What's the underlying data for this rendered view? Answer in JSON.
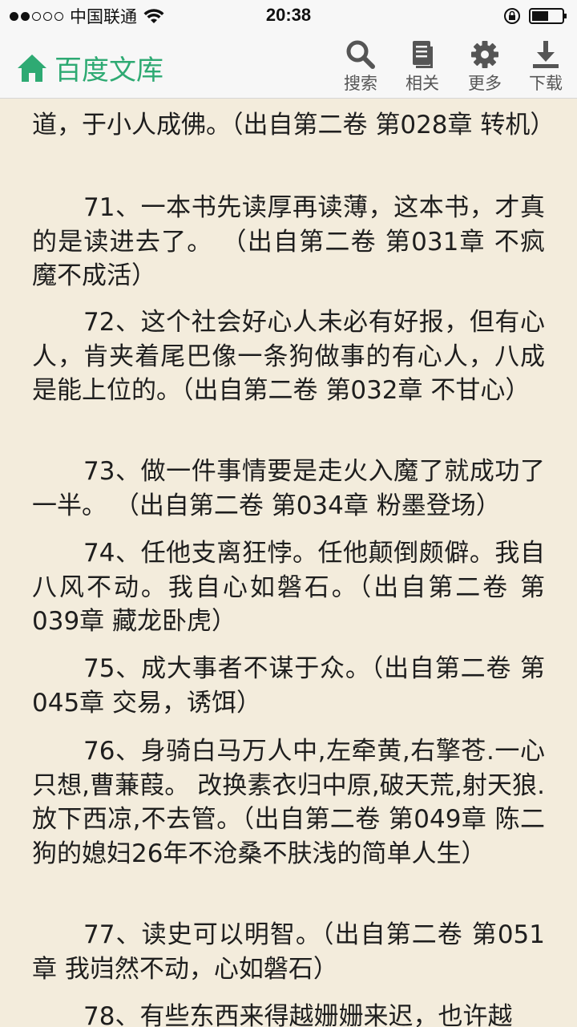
{
  "status_bar": {
    "carrier": "中国联通",
    "time": "20:38",
    "signal_bars_filled": 2,
    "signal_bars_total": 5
  },
  "toolbar": {
    "title": "百度文库",
    "brand_color": "#2eaa73",
    "actions": [
      {
        "label": "搜索",
        "icon": "search-icon"
      },
      {
        "label": "相关",
        "icon": "document-icon"
      },
      {
        "label": "更多",
        "icon": "gear-icon"
      },
      {
        "label": "下载",
        "icon": "download-icon"
      }
    ]
  },
  "content": {
    "paragraphs": [
      "道，于小人成佛。（出自第二卷 第028章 转机）",
      "71、一本书先读厚再读薄，这本书，才真的是读进去了。 （出自第二卷 第031章 不疯魔不成活）",
      "72、这个社会好心人未必有好报，但有心人，肯夹着尾巴像一条狗做事的有心人，八成是能上位的。（出自第二卷 第032章 不甘心）",
      "73、做一件事情要是走火入魔了就成功了一半。 （出自第二卷 第034章 粉墨登场）",
      "74、任他支离狂悖。任他颠倒颇僻。我自八风不动。我自心如磐石。（出自第二卷 第039章 藏龙卧虎）",
      "75、成大事者不谋于众。（出自第二卷 第045章 交易，诱饵）",
      "76、身骑白马万人中,左牵黄,右擎苍.一心只想,曹蒹葭。 改换素衣归中原,破天荒,射天狼.放下西凉,不去管。（出自第二卷 第049章 陈二狗的媳妇26年不沧桑不肤浅的简单人生）",
      "77、读史可以明智。（出自第二卷 第051章 我岿然不动，心如磐石）",
      "78、有些东西来得越姗姗来迟，也许越"
    ]
  }
}
